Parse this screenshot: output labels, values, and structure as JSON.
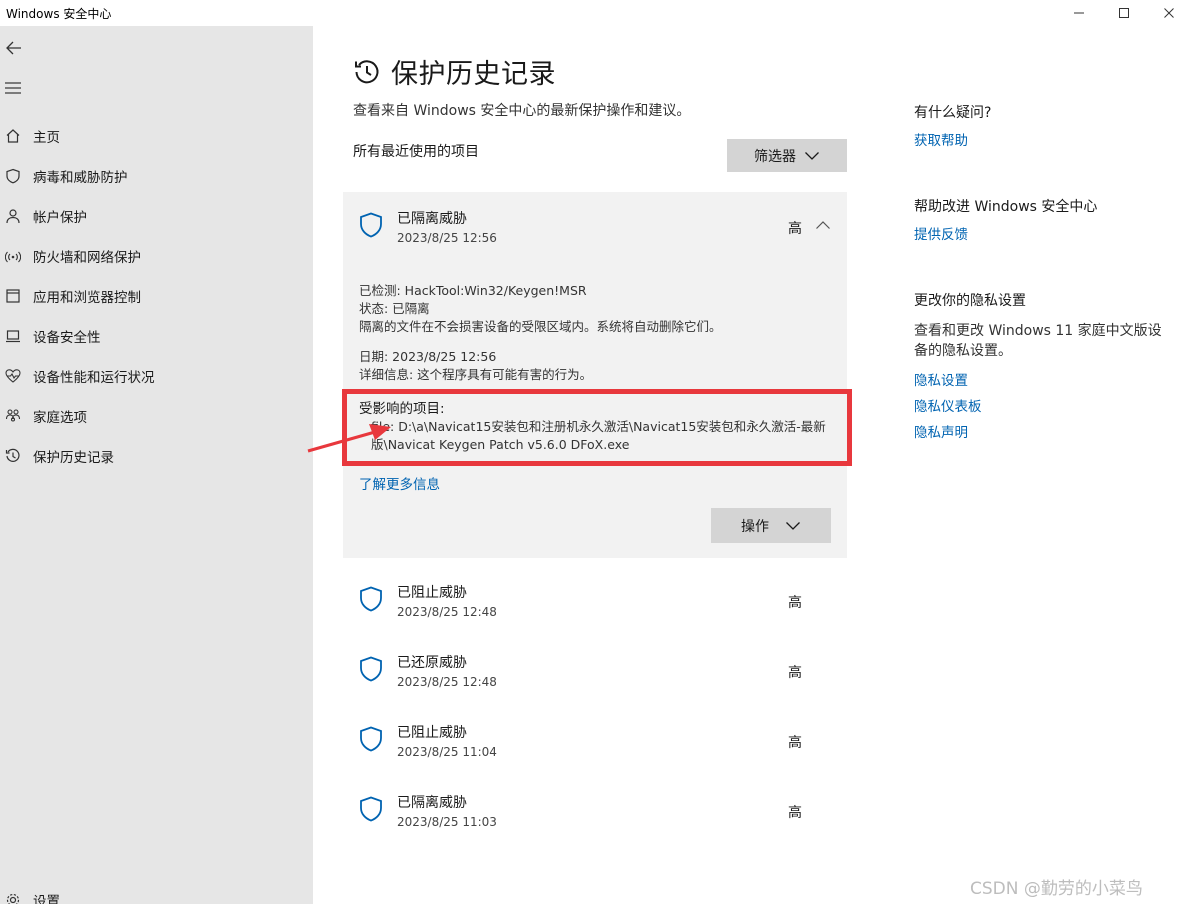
{
  "window": {
    "title": "Windows 安全中心"
  },
  "sidebar": {
    "items": [
      {
        "label": "主页",
        "icon": "home-icon"
      },
      {
        "label": "病毒和威胁防护",
        "icon": "shield-icon"
      },
      {
        "label": "帐户保护",
        "icon": "person-icon"
      },
      {
        "label": "防火墙和网络保护",
        "icon": "wifi-icon"
      },
      {
        "label": "应用和浏览器控制",
        "icon": "app-window-icon"
      },
      {
        "label": "设备安全性",
        "icon": "laptop-icon"
      },
      {
        "label": "设备性能和运行状况",
        "icon": "heart-pulse-icon"
      },
      {
        "label": "家庭选项",
        "icon": "family-icon"
      },
      {
        "label": "保护历史记录",
        "icon": "history-icon"
      }
    ],
    "settings_label": "设置"
  },
  "main": {
    "title": "保护历史记录",
    "subtitle": "查看来自 Windows 安全中心的最新保护操作和建议。",
    "recent_label": "所有最近使用的项目",
    "filter_label": "筛选器",
    "expanded": {
      "title": "已隔离威胁",
      "date": "2023/8/25 12:56",
      "severity": "高",
      "detected": "已检测:  HackTool:Win32/Keygen!MSR",
      "status": "状态:  已隔离",
      "note": "隔离的文件在不会损害设备的受限区域内。系统将自动删除它们。",
      "date_line": "日期:  2023/8/25 12:56",
      "details": "详细信息:  这个程序具有可能有害的行为。",
      "affected_label": "受影响的项目:",
      "affected_path": "file: D:\\a\\Navicat15安装包和注册机永久激活\\Navicat15安装包和永久激活-最新版\\Navicat Keygen Patch v5.6.0 DFoX.exe",
      "learn_more": "了解更多信息",
      "actions_label": "操作"
    },
    "threats": [
      {
        "title": "已阻止威胁",
        "date": "2023/8/25 12:48",
        "severity": "高"
      },
      {
        "title": "已还原威胁",
        "date": "2023/8/25 12:48",
        "severity": "高"
      },
      {
        "title": "已阻止威胁",
        "date": "2023/8/25 11:04",
        "severity": "高"
      },
      {
        "title": "已隔离威胁",
        "date": "2023/8/25 11:03",
        "severity": "高"
      }
    ]
  },
  "right": {
    "question_head": "有什么疑问?",
    "get_help": "获取帮助",
    "improve_head": "帮助改进 Windows 安全中心",
    "feedback": "提供反馈",
    "privacy_head": "更改你的隐私设置",
    "privacy_text": "查看和更改 Windows 11 家庭中文版设备的隐私设置。",
    "privacy_links": [
      "隐私设置",
      "隐私仪表板",
      "隐私声明"
    ]
  },
  "watermark": "CSDN @勤劳的小菜鸟",
  "colors": {
    "accent": "#0063b1",
    "sidebar_bg": "#e6e6e6",
    "card_bg": "#f2f2f2",
    "button_bg": "#d4d4d4",
    "annotation_red": "#e8383d"
  }
}
